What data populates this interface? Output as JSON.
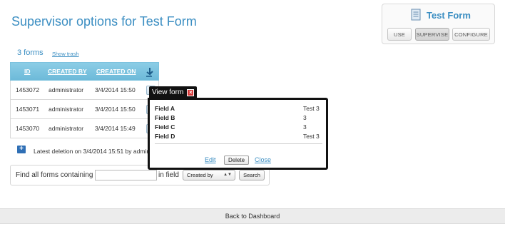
{
  "page": {
    "title": "Supervisor options for Test Form"
  },
  "form_card": {
    "title": "Test Form",
    "icon": "document-icon",
    "modes": [
      "USE",
      "SUPERVISE",
      "CONFIGURE"
    ],
    "active_mode": "SUPERVISE"
  },
  "forms": {
    "count_label": "3 forms",
    "show_trash": "Show trash",
    "columns": [
      "ID",
      "CREATED BY",
      "CREATED ON"
    ],
    "rows": [
      {
        "id": "1453072",
        "created_by": "administrator",
        "created_on": "3/4/2014 15:50"
      },
      {
        "id": "1453071",
        "created_by": "administrator",
        "created_on": "3/4/2014 15:50"
      },
      {
        "id": "1453070",
        "created_by": "administrator",
        "created_on": "3/4/2014 15:49"
      }
    ]
  },
  "deletion": {
    "text": "Latest deletion on 3/4/2014 15:51 by admin"
  },
  "search": {
    "label": "Find all forms containing",
    "value": "",
    "in_field_label": "in field",
    "field_selected": "Created by",
    "button": "Search"
  },
  "popup": {
    "tab_label": "View form",
    "fields": [
      {
        "key": "Field A",
        "value": "Test 3"
      },
      {
        "key": "Field B",
        "value": "3"
      },
      {
        "key": "Field C",
        "value": "3"
      },
      {
        "key": "Field D",
        "value": "Test 3"
      }
    ],
    "edit": "Edit",
    "delete": "Delete",
    "close": "Close"
  },
  "footer": {
    "link": "Back to Dashboard"
  },
  "colors": {
    "accent": "#3b8ec2",
    "table_header": "#7cc2de",
    "popup_border": "#111111",
    "close_red": "#d83a3a"
  }
}
